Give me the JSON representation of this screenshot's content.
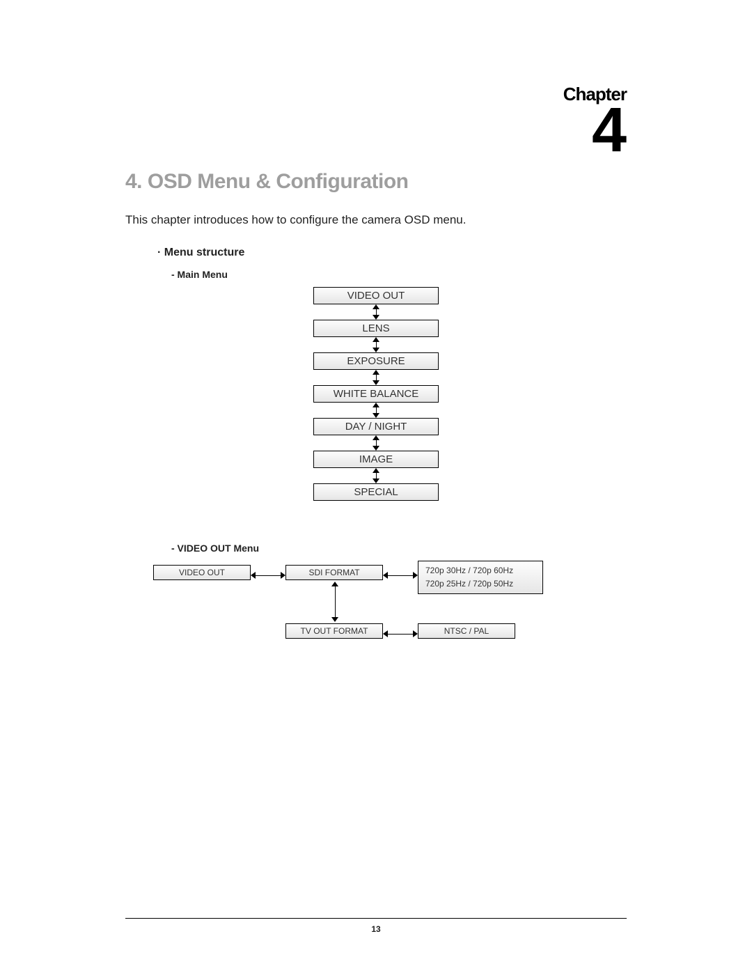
{
  "chapter": {
    "label": "Chapter",
    "number": "4"
  },
  "title": "4. OSD Menu & Configuration",
  "intro": "This chapter introduces how to configure the camera OSD menu.",
  "section": {
    "bullet": "·",
    "title": "Menu structure"
  },
  "main_menu": {
    "heading": "- Main Menu",
    "items": [
      "VIDEO OUT",
      "LENS",
      "EXPOSURE",
      "WHITE BALANCE",
      "DAY / NIGHT",
      "IMAGE",
      "SPECIAL"
    ]
  },
  "video_out": {
    "heading": "- VIDEO OUT Menu",
    "root": "VIDEO OUT",
    "sdi": "SDI FORMAT",
    "sdi_opts_line1": "720p 30Hz / 720p 60Hz",
    "sdi_opts_line2": "720p 25Hz / 720p 50Hz",
    "tv": "TV OUT FORMAT",
    "tv_opts": "NTSC / PAL"
  },
  "page_number": "13"
}
